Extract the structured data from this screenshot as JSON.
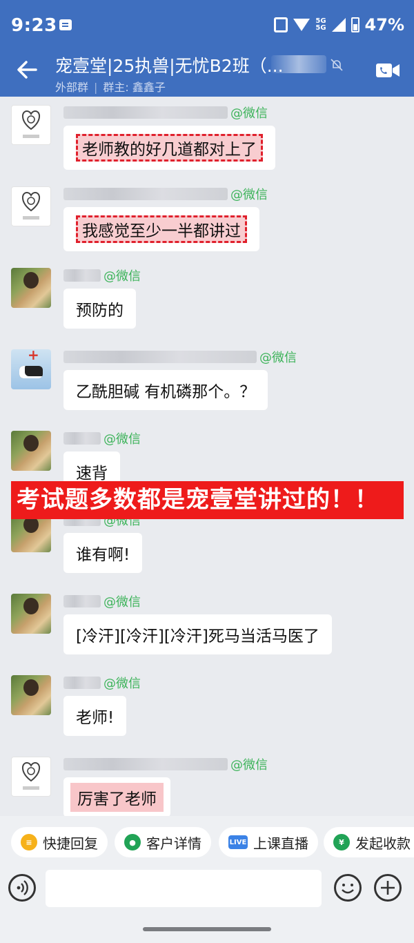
{
  "status": {
    "time": "9:23",
    "net_top": "5G",
    "net_bottom": "5G",
    "battery": "47%"
  },
  "header": {
    "title": "宠壹堂|25执兽|无忧B2班（...",
    "external": "外部群",
    "owner": "群主: 鑫鑫子"
  },
  "messages": [
    {
      "avatar": "logo",
      "tag": "@微信",
      "text": "老师教的好几道都对上了",
      "style": "hl-dash"
    },
    {
      "avatar": "logo",
      "tag": "@微信",
      "text": "我感觉至少一半都讲过",
      "style": "hl-dash"
    },
    {
      "avatar": "photo",
      "tag": "@微信",
      "text": "预防的",
      "style": "plain"
    },
    {
      "avatar": "cow",
      "tag": "@微信",
      "text": "乙酰胆碱  有机磷那个。？",
      "style": "plain"
    },
    {
      "avatar": "photo",
      "tag": "@微信",
      "text": "速背",
      "style": "plain"
    },
    {
      "avatar": "photo",
      "tag": "@微信",
      "text": "谁有啊!",
      "style": "plain"
    },
    {
      "avatar": "photo",
      "tag": "@微信",
      "text": "[冷汗][冷汗][冷汗]死马当活马医了",
      "style": "plain"
    },
    {
      "avatar": "photo",
      "tag": "@微信",
      "text": "老师!",
      "style": "plain"
    },
    {
      "avatar": "logo",
      "tag": "@微信",
      "text": "厉害了老师",
      "style": "hl"
    }
  ],
  "banner": "考试题多数都是宠壹堂讲过的！！",
  "quick_actions": [
    {
      "label": "快捷回复",
      "icon": "chat-bubble-icon"
    },
    {
      "label": "客户详情",
      "icon": "user-detail-icon"
    },
    {
      "label": "上课直播",
      "icon": "live-icon",
      "badge": "LIVE"
    },
    {
      "label": "发起收款",
      "icon": "payment-icon",
      "badge": "¥"
    }
  ],
  "colors": {
    "header": "#3f6fbf",
    "wechat_tag": "#3db35a",
    "banner": "#ee1b1b",
    "highlight": "#f8cdd0"
  }
}
